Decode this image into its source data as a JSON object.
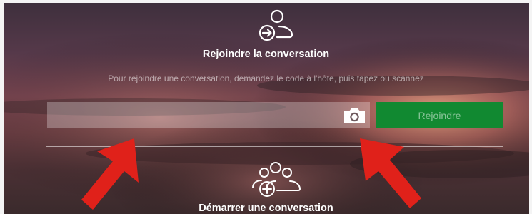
{
  "join": {
    "icon": "person-arrow-icon",
    "title": "Rejoindre la conversation",
    "subtitle": "Pour rejoindre une conversation, demandez le code à l'hôte, puis tapez ou scannez",
    "code_value": "",
    "camera_icon": "camera-icon",
    "button_label": "Rejoindre"
  },
  "start": {
    "icon": "group-add-icon",
    "title": "Démarrer une conversation"
  },
  "annotations": {
    "arrow_color": "#e0211a"
  },
  "colors": {
    "accent_green": "#118931"
  }
}
